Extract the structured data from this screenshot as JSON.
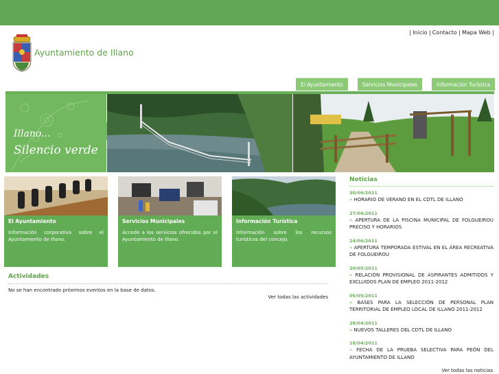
{
  "header": {
    "site_title": "Ayuntamiento de Illano",
    "links": [
      "| Inicio |",
      "Contacto |",
      "Mapa Web |"
    ]
  },
  "nav": {
    "tabs": [
      "El Ayuntamiento",
      "Servicios Municipales",
      "Información Turística"
    ]
  },
  "banner": {
    "line1": "Illano...",
    "line2": "Silencio verde"
  },
  "boxes": [
    {
      "title": "El Ayuntamiento",
      "text": "Información corporativa sobre el Ayuntamiento de Illano."
    },
    {
      "title": "Servicios Municipales",
      "text": "Accede a los servicios ofrecidos por el Ayuntamiento de Illano."
    },
    {
      "title": "Información Turística",
      "text": "Información sobre los recursos turísticos del concejo."
    }
  ],
  "activities": {
    "title": "Actividades",
    "empty": "No se han encontrado próximos eventos en la base de datos.",
    "view_all": "Ver todas las actividades"
  },
  "news": {
    "title": "Noticias",
    "items": [
      {
        "date": "30/06/2011",
        "text": "HORARIO DE VERANO EN EL CDTL DE ILLANO"
      },
      {
        "date": "27/06/2011",
        "text": "APERTURA DE LA PISCINA MUNICIPAL DE FOLGUEIROU PRECISO Y HORARIOS"
      },
      {
        "date": "24/06/2011",
        "text": "APERTURA TEMPORADA ESTIVAL EN EL ÁREA RECREATIVA DE FOLGUEIROU"
      },
      {
        "date": "20/05/2011",
        "text": "RELACIÓN PROVISIONAL DE ASPIRANTES ADMITIDOS Y EXCLUIDOS PLAN DE EMPLEO 2011-2012"
      },
      {
        "date": "05/05/2011",
        "text": "BASES PARA LA SELECCIÓN DE PERSONAL PLAN TERRITORIAL DE EMPLEO LOCAL DE ILLANO 2011-2012"
      },
      {
        "date": "28/04/2011",
        "text": "NUEVOS TALLERES DEL CDTL DE ILLANO"
      },
      {
        "date": "18/04/2011",
        "text": "FECHA DE LA PRUEBA SELECTIVA PARA PEÓN DEL AYUNTAMIENTO DE ILLANO"
      }
    ],
    "view_all": "Ver todas las noticias"
  }
}
